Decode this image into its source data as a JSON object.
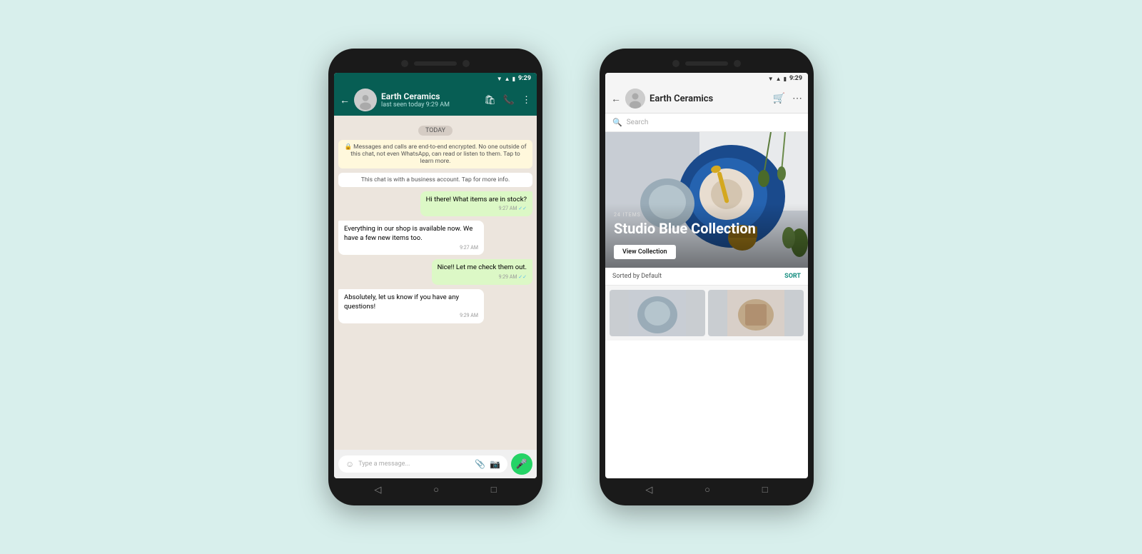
{
  "background_color": "#d8efec",
  "phone1": {
    "time": "9:29",
    "contact_name": "Earth Ceramics",
    "contact_status": "last seen today 9:29 AM",
    "header_icons": [
      "bag",
      "phone-add",
      "more-vert"
    ],
    "system_messages": [
      "🔒 Messages and calls are end-to-end encrypted. No one outside of this chat, not even WhatsApp, can read or listen to them. Tap to learn more.",
      "This chat is with a business account. Tap for more info."
    ],
    "date_label": "TODAY",
    "messages": [
      {
        "type": "sent",
        "text": "Hi there! What items are in stock?",
        "time": "9:27 AM",
        "read": true
      },
      {
        "type": "received",
        "text": "Everything in our shop is available now. We have a few new items too.",
        "time": "9:27 AM"
      },
      {
        "type": "sent",
        "text": "Nice!! Let me check them out.",
        "time": "9:29 AM",
        "read": true
      },
      {
        "type": "received",
        "text": "Absolutely, let us know if you have any questions!",
        "time": "9:29 AM"
      }
    ],
    "input_placeholder": "Type a message..."
  },
  "phone2": {
    "time": "9:29",
    "shop_name": "Earth Ceramics",
    "search_placeholder": "Search",
    "hero": {
      "items_count": "24 ITEMS",
      "title": "Studio Blue Collection",
      "btn_label": "View Collection"
    },
    "sort_label": "Sorted by Default",
    "sort_btn": "SORT"
  }
}
